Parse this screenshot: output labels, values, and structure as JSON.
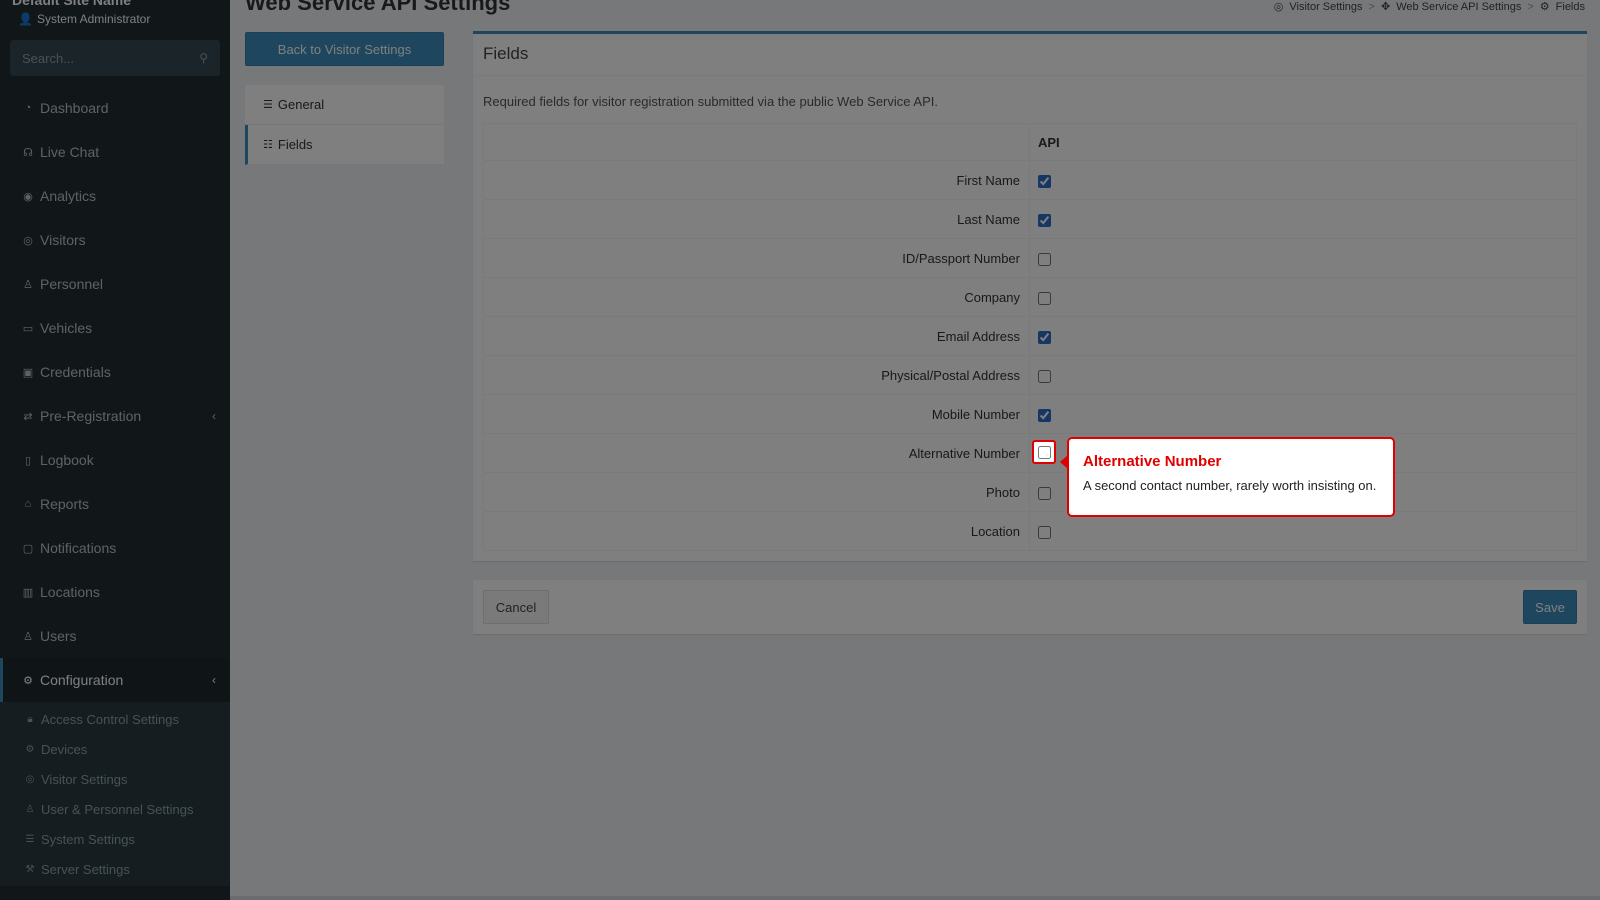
{
  "sidebar": {
    "site_name": "Default Site Name",
    "user_role": "System Administrator",
    "search_placeholder": "Search...",
    "items": [
      {
        "label": "Dashboard",
        "icon": "dashboard-icon"
      },
      {
        "label": "Live Chat",
        "icon": "headset-icon"
      },
      {
        "label": "Analytics",
        "icon": "analytics-icon"
      },
      {
        "label": "Visitors",
        "icon": "eye-icon"
      },
      {
        "label": "Personnel",
        "icon": "personnel-icon"
      },
      {
        "label": "Vehicles",
        "icon": "car-icon"
      },
      {
        "label": "Credentials",
        "icon": "badge-icon"
      },
      {
        "label": "Pre-Registration",
        "icon": "pre-registration-icon"
      },
      {
        "label": "Logbook",
        "icon": "book-icon"
      },
      {
        "label": "Reports",
        "icon": "chart-icon"
      },
      {
        "label": "Notifications",
        "icon": "chat-icon"
      },
      {
        "label": "Locations",
        "icon": "map-icon"
      },
      {
        "label": "Users",
        "icon": "users-icon"
      },
      {
        "label": "Configuration",
        "icon": "gear-icon"
      }
    ],
    "sub_items": [
      {
        "label": "Access Control Settings",
        "icon": "lock-icon"
      },
      {
        "label": "Devices",
        "icon": "device-icon"
      },
      {
        "label": "Visitor Settings",
        "icon": "eye-icon"
      },
      {
        "label": "User & Personnel Settings",
        "icon": "users-gear-icon"
      },
      {
        "label": "System Settings",
        "icon": "sliders-icon"
      },
      {
        "label": "Server Settings",
        "icon": "wrench-icon"
      }
    ]
  },
  "page": {
    "title": "Web Service API Settings",
    "breadcrumb": [
      "Visitor Settings",
      "Web Service API Settings",
      "Fields"
    ],
    "back_button": "Back to Visitor Settings",
    "tabs": [
      "General",
      "Fields"
    ]
  },
  "fields_box": {
    "title": "Fields",
    "description": "Required fields for visitor registration submitted via the public Web Service API.",
    "column_header": "API",
    "rows": [
      {
        "label": "First Name",
        "checked": true
      },
      {
        "label": "Last Name",
        "checked": true
      },
      {
        "label": "ID/Passport Number",
        "checked": false
      },
      {
        "label": "Company",
        "checked": false
      },
      {
        "label": "Email Address",
        "checked": true
      },
      {
        "label": "Physical/Postal Address",
        "checked": false
      },
      {
        "label": "Mobile Number",
        "checked": true
      },
      {
        "label": "Alternative Number",
        "checked": false
      },
      {
        "label": "Photo",
        "checked": false
      },
      {
        "label": "Location",
        "checked": false
      }
    ]
  },
  "footer": {
    "cancel": "Cancel",
    "save": "Save"
  },
  "tooltip": {
    "title": "Alternative Number",
    "text": "A second contact number, rarely worth insisting on.",
    "accent_color": "#e00000"
  }
}
